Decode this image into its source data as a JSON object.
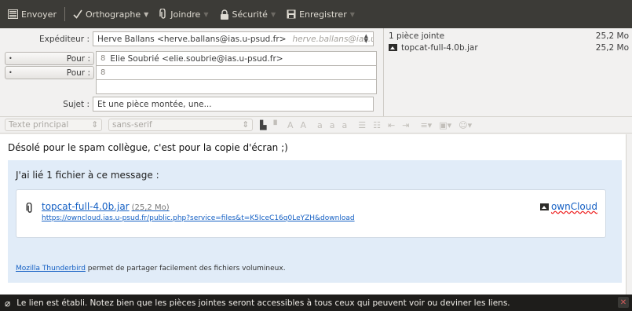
{
  "toolbar": {
    "send": "Envoyer",
    "spelling": "Orthographe",
    "attach": "Joindre",
    "security": "Sécurité",
    "save": "Enregistrer"
  },
  "headers": {
    "from_label": "Expéditeur :",
    "from_value": "Herve Ballans <herve.ballans@ias.u-psud.fr>",
    "from_ghost": "herve.ballans@ias.u-p...",
    "to_label_1": "Pour :",
    "to_value_1": "Elie Soubrié <elie.soubrie@ias.u-psud.fr>",
    "to_label_2": "Pour :",
    "to_value_2": "",
    "subject_label": "Sujet :",
    "subject_value": "Et une pièce montée, une..."
  },
  "attachments": {
    "summary": "1 pièce jointe",
    "summary_size": "25,2 Mo",
    "items": [
      {
        "name": "topcat-full-4.0b.jar",
        "size": "25,2 Mo"
      }
    ]
  },
  "format": {
    "paragraph_style": "Texte principal",
    "font": "sans-serif"
  },
  "body": {
    "intro": "Désolé pour le spam collègue, c'est pour la copie d'écran ;)",
    "panel_title": "J'ai lié 1 fichier à ce message :",
    "file_name": "topcat-full-4.0b.jar",
    "file_size": "(25,2 Mo)",
    "file_url": "https://owncloud.ias.u-psud.fr/public.php?service=files&t=K5IceC16q0LeYZH&download",
    "provider": "ownCloud",
    "footer_link": "Mozilla Thunderbird",
    "footer_text": " permet de partager facilement des fichiers volumineux."
  },
  "notification": {
    "text": "Le lien est établi. Notez bien que les pièces jointes seront accessibles à tous ceux qui peuvent voir ou deviner les liens."
  }
}
